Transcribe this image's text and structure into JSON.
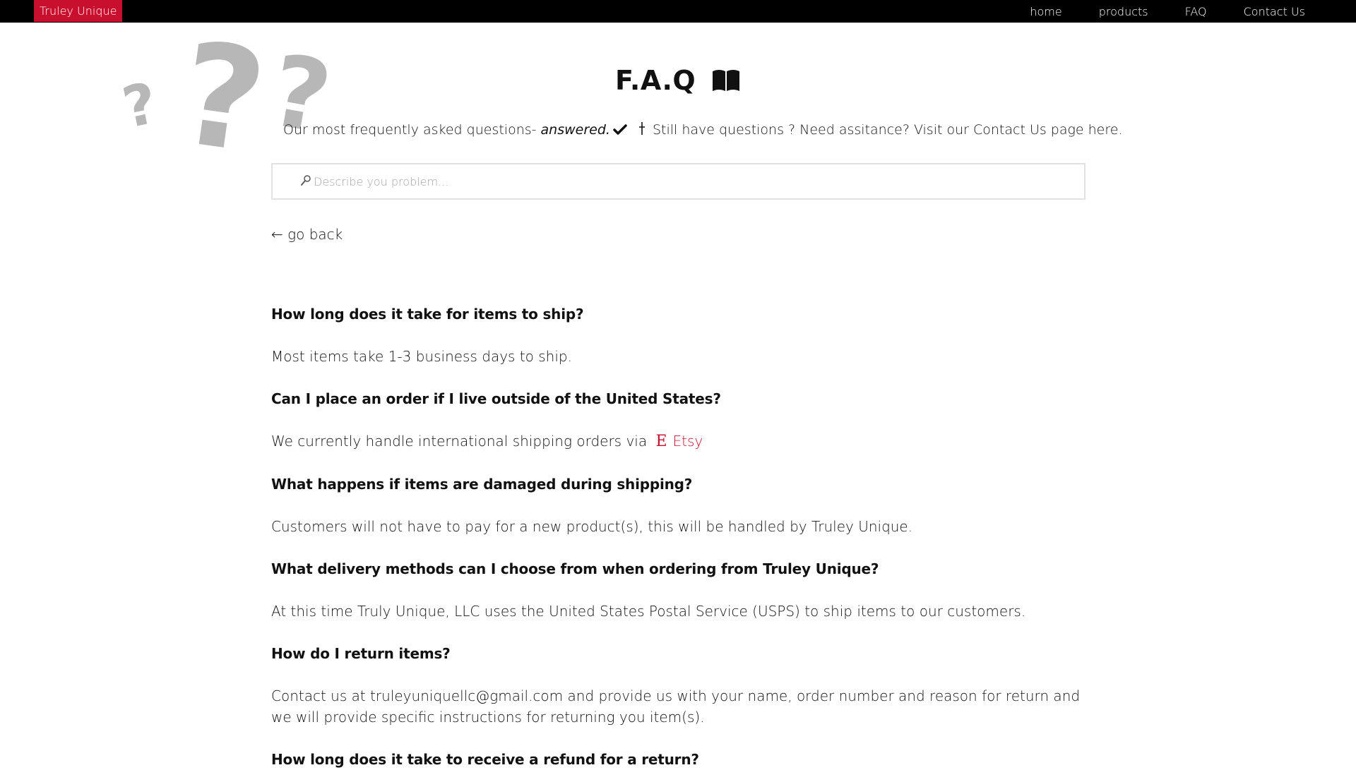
{
  "nav": {
    "brand": "Truley Unique",
    "links": [
      "home",
      "products",
      "FAQ",
      "Contact Us"
    ]
  },
  "hero": {
    "title": "F.A.Q",
    "intro_prefix": "Our most frequently asked questions- ",
    "intro_emphasis": "answered.",
    "intro_suffix": "Still have questions ? Need assitance? Visit our Contact Us page here."
  },
  "search": {
    "placeholder": "Describe you problem...",
    "value": ""
  },
  "go_back": "← go back",
  "faqs": [
    {
      "question": "How long does it take for items to ship?",
      "answer": "Most items take 1-3 business days to ship."
    },
    {
      "question": "Can I place an order if I live outside of the United States?",
      "answer": "We currently handle international shipping orders via",
      "link_icon": "E",
      "link_label": "Etsy"
    },
    {
      "question": "What happens if items are damaged during shipping?",
      "answer": "Customers will not have to pay for a new product(s), this will be handled by Truley Unique."
    },
    {
      "question": "What delivery methods can I choose from when ordering from Truley Unique?",
      "answer": "At this time Truly Unique, LLC uses the United States Postal Service (USPS) to ship items to our customers."
    },
    {
      "question": "How do I return items?",
      "answer": "Contact us at truleyuniquellc@gmail.com and provide us with your name, order number and reason for return and we will provide specific instructions for returning you item(s)."
    },
    {
      "question": "How long does it take to receive a refund for a return?",
      "answer": ""
    }
  ],
  "colors": {
    "brand": "#c8102e",
    "nav_bg": "#000000",
    "decor": "#b7b7b7"
  },
  "icons": {
    "book": "book-icon",
    "check": "check-icon",
    "search": "search-icon",
    "etsy": "etsy-icon",
    "decor": "question-mark-icon"
  }
}
